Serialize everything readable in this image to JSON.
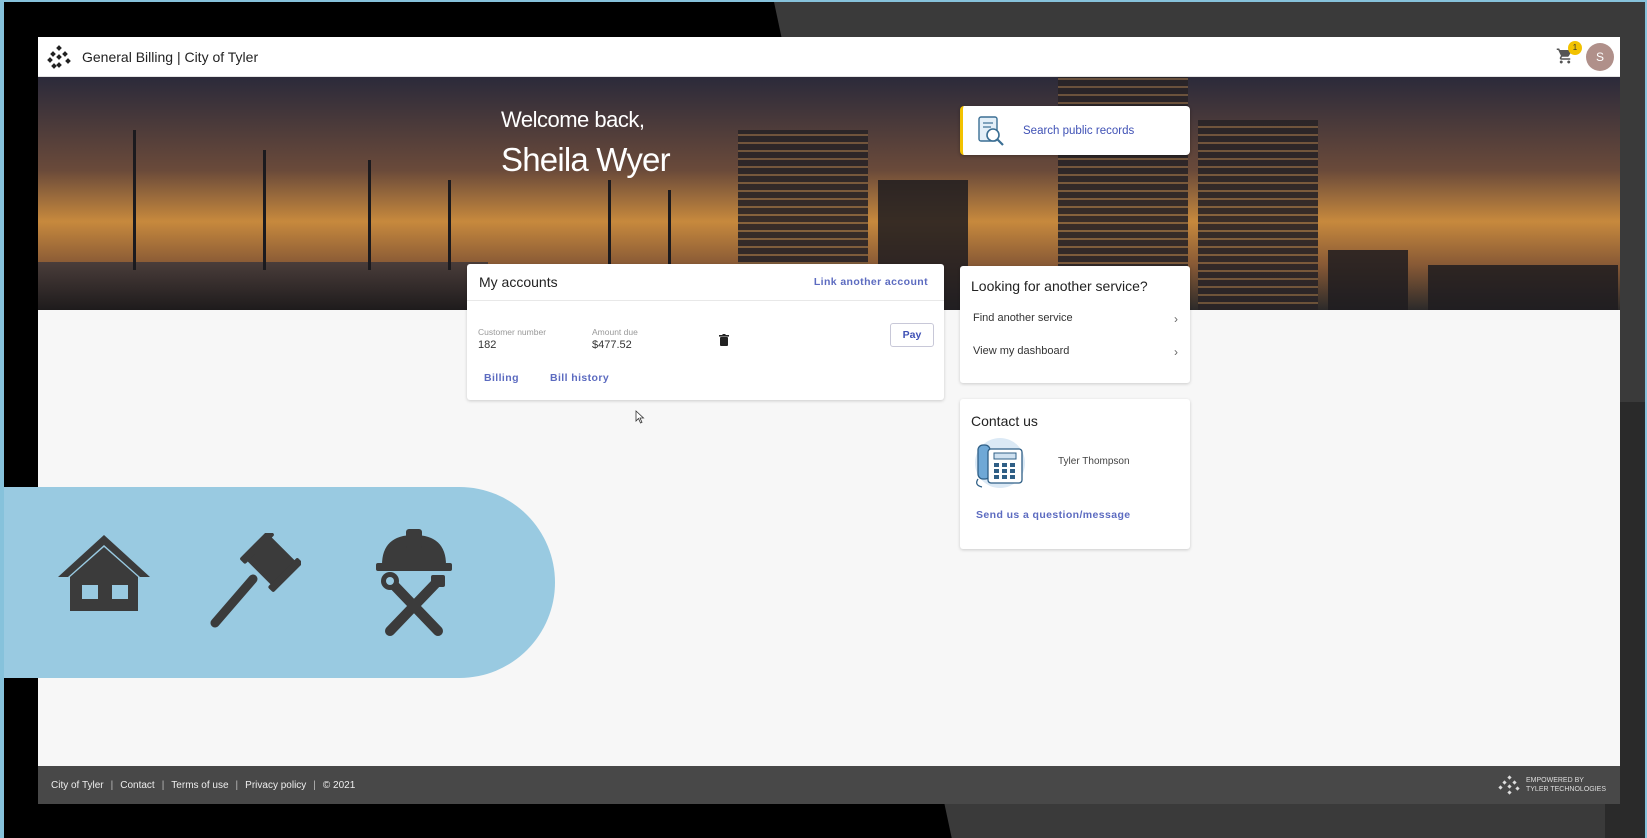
{
  "header": {
    "app_title": "General Billing | City of Tyler",
    "cart_count": "1",
    "avatar_initial": "S"
  },
  "hero": {
    "welcome_line": "Welcome back,",
    "user_name": "Sheila Wyer",
    "search_label": "Search public records"
  },
  "accounts": {
    "title": "My accounts",
    "link_label": "Link another account",
    "customer_number_label": "Customer number",
    "customer_number": "182",
    "amount_due_label": "Amount due",
    "amount_due": "$477.52",
    "pay_label": "Pay",
    "billing_label": "Billing",
    "bill_history_label": "Bill history"
  },
  "services": {
    "title": "Looking for another service?",
    "items": [
      {
        "label": "Find another service"
      },
      {
        "label": "View my dashboard"
      }
    ]
  },
  "contact": {
    "title": "Contact us",
    "name": "Tyler Thompson",
    "message_label": "Send us a question/message"
  },
  "footer": {
    "links": [
      "City of Tyler",
      "Contact",
      "Terms of use",
      "Privacy policy",
      "© 2021"
    ],
    "powered_line1": "EMPOWERED BY",
    "powered_line2": "TYLER TECHNOLOGIES"
  },
  "overlay_icons": [
    "house-icon",
    "gavel-icon",
    "hardhat-tools-icon"
  ],
  "colors": {
    "accent": "#3f51b5",
    "highlight": "#f2c200",
    "overlay": "#99cae1",
    "footer_bg": "#484848"
  }
}
